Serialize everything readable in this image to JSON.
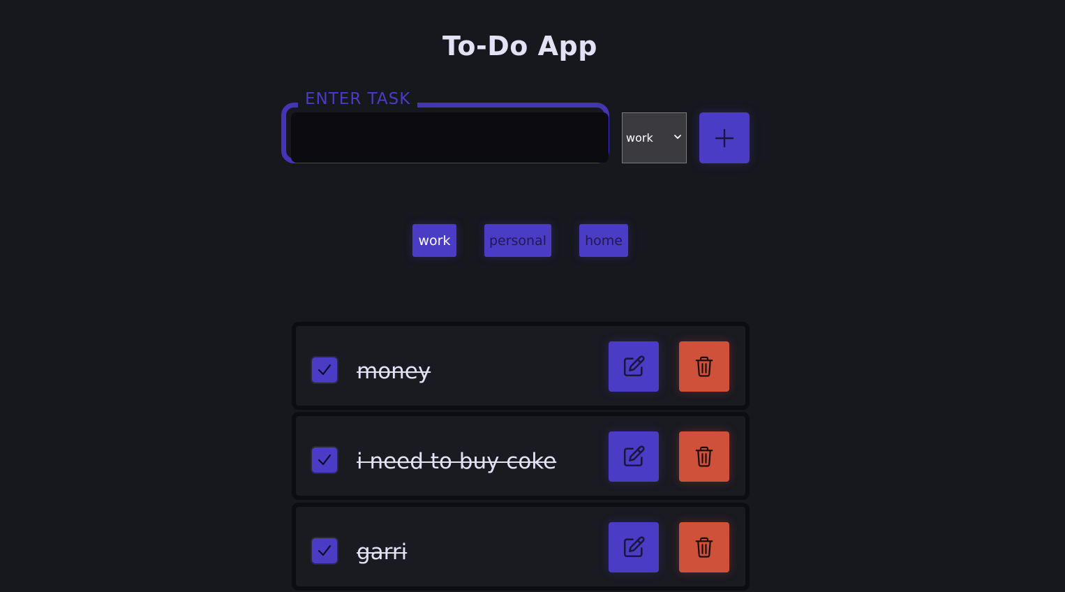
{
  "app": {
    "title": "To-Do App"
  },
  "task_form": {
    "legend": "ENTER TASK",
    "input_value": "",
    "category_select": {
      "selected": "work"
    },
    "add_icon": "plus-icon"
  },
  "filters": [
    {
      "label": "work",
      "active": true
    },
    {
      "label": "personal",
      "active": false
    },
    {
      "label": "home",
      "active": false
    }
  ],
  "tasks": [
    {
      "text": "money",
      "completed": true
    },
    {
      "text": "i need to buy coke",
      "completed": true
    },
    {
      "text": "garri",
      "completed": true
    }
  ],
  "icons": {
    "edit": "pencil-square-icon",
    "delete": "trash-icon",
    "check": "check-icon"
  },
  "colors": {
    "background": "#17171e",
    "accent": "#4a3cc4",
    "danger": "#d0513a",
    "text": "#e3e2f5"
  }
}
